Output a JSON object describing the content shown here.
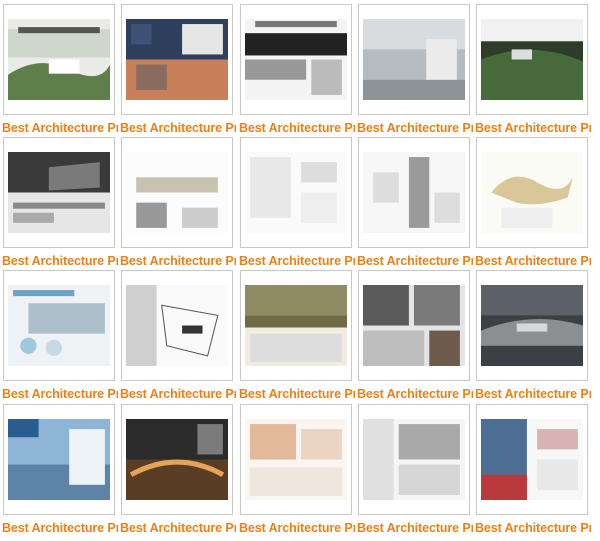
{
  "gallery": {
    "items": [
      {
        "caption": "Best Architecture Pr...",
        "variant": "landscape-green"
      },
      {
        "caption": "Best Architecture Pr...",
        "variant": "dusk-collage"
      },
      {
        "caption": "Best Architecture Pr...",
        "variant": "agency-board"
      },
      {
        "caption": "Best Architecture Pr...",
        "variant": "misty-sky"
      },
      {
        "caption": "Best Architecture Pr...",
        "variant": "forest-aerial"
      },
      {
        "caption": "Best Architecture Pr...",
        "variant": "dark-model"
      },
      {
        "caption": "Best Architecture Pr...",
        "variant": "minimal-sheet"
      },
      {
        "caption": "Best Architecture Pr...",
        "variant": "sketch-sheet"
      },
      {
        "caption": "Best Architecture Pr...",
        "variant": "gray-column"
      },
      {
        "caption": "Best Architecture Pr...",
        "variant": "organic-plan"
      },
      {
        "caption": "Best Architecture Pr...",
        "variant": "social-housing"
      },
      {
        "caption": "Best Architecture Pr...",
        "variant": "site-map"
      },
      {
        "caption": "Best Architecture Pr...",
        "variant": "sunset-panorama"
      },
      {
        "caption": "Best Architecture Pr...",
        "variant": "forest-collage"
      },
      {
        "caption": "Best Architecture Pr...",
        "variant": "misty-valley"
      },
      {
        "caption": "Best Architecture Pr...",
        "variant": "dpc-sky"
      },
      {
        "caption": "Best Architecture Pr...",
        "variant": "night-render"
      },
      {
        "caption": "Best Architecture Pr...",
        "variant": "pinkish-plans"
      },
      {
        "caption": "Best Architecture Pr...",
        "variant": "gray-sheet"
      },
      {
        "caption": "Best Architecture Pr...",
        "variant": "nesting-theaters"
      },
      {
        "caption": "Best Architecture Pr...",
        "variant": "sketchy-forest"
      }
    ]
  }
}
